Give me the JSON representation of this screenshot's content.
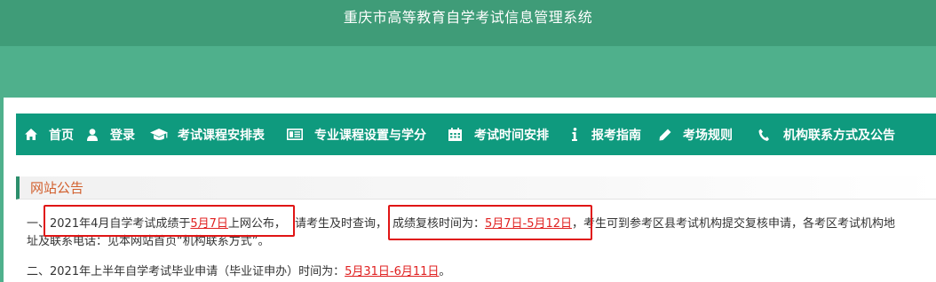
{
  "site": {
    "title": "重庆市高等教育自学考试信息管理系统"
  },
  "nav": {
    "items": [
      {
        "icon": "home-icon",
        "label": "首页"
      },
      {
        "icon": "user-icon",
        "label": "登录"
      },
      {
        "icon": "graduation-cap-icon",
        "label": "考试课程安排表"
      },
      {
        "icon": "list-card-icon",
        "label": "专业课程设置与学分"
      },
      {
        "icon": "calendar-icon",
        "label": "考试时间安排"
      },
      {
        "icon": "info-icon",
        "label": "报考指南"
      },
      {
        "icon": "pencil-icon",
        "label": "考场规则"
      },
      {
        "icon": "phone-icon",
        "label": "机构联系方式及公告"
      }
    ]
  },
  "notice": {
    "heading": "网站公告",
    "item1": {
      "prefix": "一、",
      "part_a": "2021年4月自学考试成绩于",
      "date_release": "5月7日",
      "part_b": "上网公布，",
      "part_c": "请考生及时查询，",
      "part_d": "成绩复核时间为：",
      "review_period": "5月7日-5月12日",
      "part_e": "，考生可到参考区县考试机构提交复核申请，各考区考试机构地",
      "line2": "址及联系电话：见本网站首页“机构联系方式”。"
    },
    "item2": {
      "text": "二、2021年上半年自学考试毕业申请（毕业证申办）时间为：",
      "period": "5月31日-6月11日",
      "suffix": "。"
    }
  },
  "colors": {
    "header_bg": "#3f9c78",
    "band_bg": "#4fb08c",
    "nav_bg": "#0f9a7e",
    "heading_text": "#d2602e",
    "link_red": "#e02020",
    "highlight_box": "#e01515"
  }
}
